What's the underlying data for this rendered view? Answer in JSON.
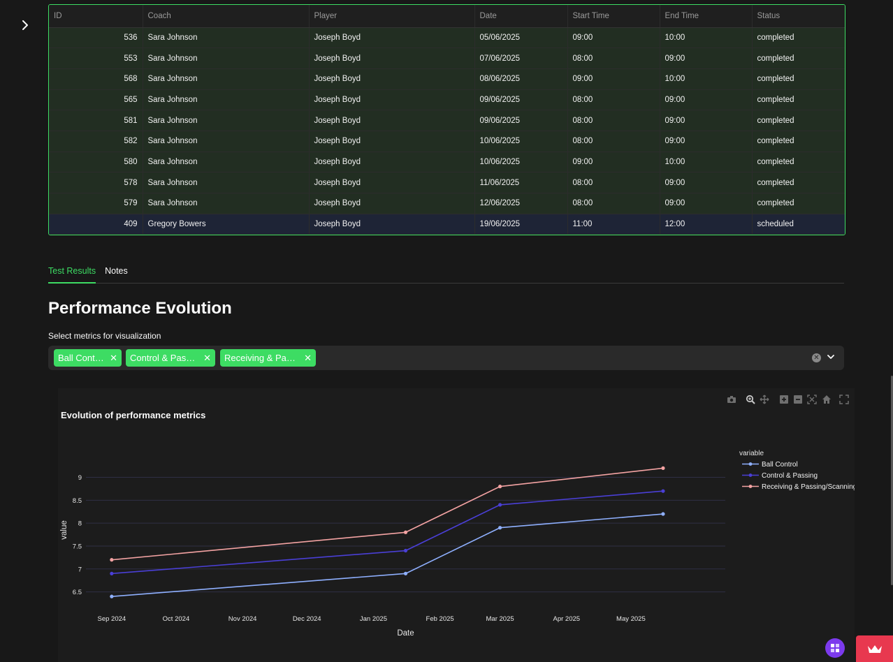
{
  "table": {
    "columns": [
      "ID",
      "Coach",
      "Player",
      "Date",
      "Start Time",
      "End Time",
      "Status"
    ],
    "rows": [
      {
        "id": "536",
        "coach": "Sara Johnson",
        "player": "Joseph Boyd",
        "date": "05/06/2025",
        "start": "09:00",
        "end": "10:00",
        "status": "completed"
      },
      {
        "id": "553",
        "coach": "Sara Johnson",
        "player": "Joseph Boyd",
        "date": "07/06/2025",
        "start": "08:00",
        "end": "09:00",
        "status": "completed"
      },
      {
        "id": "568",
        "coach": "Sara Johnson",
        "player": "Joseph Boyd",
        "date": "08/06/2025",
        "start": "09:00",
        "end": "10:00",
        "status": "completed"
      },
      {
        "id": "565",
        "coach": "Sara Johnson",
        "player": "Joseph Boyd",
        "date": "09/06/2025",
        "start": "08:00",
        "end": "09:00",
        "status": "completed"
      },
      {
        "id": "581",
        "coach": "Sara Johnson",
        "player": "Joseph Boyd",
        "date": "09/06/2025",
        "start": "08:00",
        "end": "09:00",
        "status": "completed"
      },
      {
        "id": "582",
        "coach": "Sara Johnson",
        "player": "Joseph Boyd",
        "date": "10/06/2025",
        "start": "08:00",
        "end": "09:00",
        "status": "completed"
      },
      {
        "id": "580",
        "coach": "Sara Johnson",
        "player": "Joseph Boyd",
        "date": "10/06/2025",
        "start": "09:00",
        "end": "10:00",
        "status": "completed"
      },
      {
        "id": "578",
        "coach": "Sara Johnson",
        "player": "Joseph Boyd",
        "date": "11/06/2025",
        "start": "08:00",
        "end": "09:00",
        "status": "completed"
      },
      {
        "id": "579",
        "coach": "Sara Johnson",
        "player": "Joseph Boyd",
        "date": "12/06/2025",
        "start": "08:00",
        "end": "09:00",
        "status": "completed"
      },
      {
        "id": "409",
        "coach": "Gregory Bowers",
        "player": "Joseph Boyd",
        "date": "19/06/2025",
        "start": "11:00",
        "end": "12:00",
        "status": "scheduled"
      }
    ]
  },
  "tabs": [
    {
      "label": "Test Results",
      "active": true
    },
    {
      "label": "Notes",
      "active": false
    }
  ],
  "section_title": "Performance Evolution",
  "metrics_select": {
    "label": "Select metrics for visualization",
    "chips": [
      "Ball Control",
      "Control & Passing",
      "Receiving & Pass..."
    ]
  },
  "chart_data": {
    "type": "line",
    "title": "Evolution of performance metrics",
    "xlabel": "Date",
    "ylabel": "value",
    "legend_title": "variable",
    "legend_position": "right",
    "x": [
      "2024-09-01",
      "2025-01-16",
      "2025-03-01",
      "2025-05-16"
    ],
    "x_ticks": [
      "Sep 2024",
      "Oct 2024",
      "Nov 2024",
      "Dec 2024",
      "Jan 2025",
      "Feb 2025",
      "Mar 2025",
      "Apr 2025",
      "May 2025"
    ],
    "x_tick_dates": [
      "2024-09-01",
      "2024-10-01",
      "2024-11-01",
      "2024-12-01",
      "2025-01-01",
      "2025-02-01",
      "2025-03-01",
      "2025-04-01",
      "2025-05-01"
    ],
    "y_ticks": [
      6.5,
      7,
      7.5,
      8,
      8.5,
      9
    ],
    "ylim": [
      6.25,
      9.45
    ],
    "xlim": [
      "2024-08-20",
      "2025-06-14"
    ],
    "grid": true,
    "series": [
      {
        "name": "Ball Control",
        "color": "#8fb0ff",
        "values": [
          6.4,
          6.9,
          7.9,
          8.2
        ]
      },
      {
        "name": "Control & Passing",
        "color": "#4a3fd6",
        "values": [
          6.9,
          7.4,
          8.4,
          8.7
        ]
      },
      {
        "name": "Receiving & Passing/Scanning",
        "color": "#f4a3a3",
        "values": [
          7.2,
          7.8,
          8.8,
          9.2
        ]
      }
    ]
  },
  "colors": {
    "accent": "#3ddc63",
    "completed_row": "#222e22",
    "scheduled_row": "#1e2436",
    "deploy_badge": "#e8384f"
  }
}
